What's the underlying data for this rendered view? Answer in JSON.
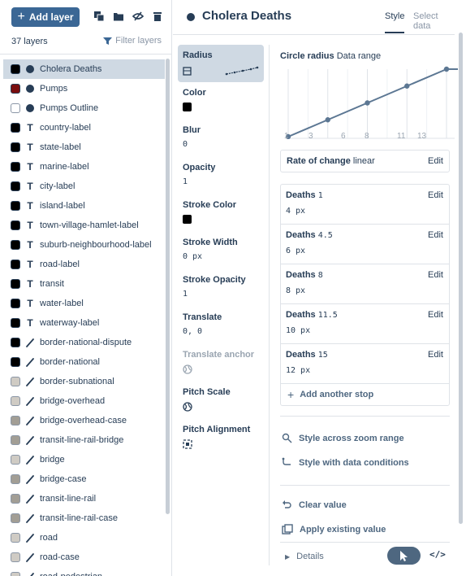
{
  "toolbar": {
    "add_layer_label": "Add layer"
  },
  "layer_panel": {
    "count_label": "37 layers",
    "filter_label": "Filter layers",
    "layers": [
      {
        "name": "Cholera Deaths",
        "icon": "circle-icon",
        "vis": "#000000",
        "selected": true
      },
      {
        "name": "Pumps",
        "icon": "circle-icon",
        "vis": "#7a0e0e"
      },
      {
        "name": "Pumps Outline",
        "icon": "circle-icon",
        "vis": "#ffffff"
      },
      {
        "name": "country-label",
        "icon": "text-icon",
        "vis": "#000000"
      },
      {
        "name": "state-label",
        "icon": "text-icon",
        "vis": "#000000"
      },
      {
        "name": "marine-label",
        "icon": "text-icon",
        "vis": "#000000"
      },
      {
        "name": "city-label",
        "icon": "text-icon",
        "vis": "#000000"
      },
      {
        "name": "island-label",
        "icon": "text-icon",
        "vis": "#000000"
      },
      {
        "name": "town-village-hamlet-label",
        "icon": "text-icon",
        "vis": "#000000"
      },
      {
        "name": "suburb-neighbourhood-label",
        "icon": "text-icon",
        "vis": "#000000"
      },
      {
        "name": "road-label",
        "icon": "text-icon",
        "vis": "#000000"
      },
      {
        "name": "transit",
        "icon": "text-icon",
        "vis": "#000000"
      },
      {
        "name": "water-label",
        "icon": "text-icon",
        "vis": "#000000"
      },
      {
        "name": "waterway-label",
        "icon": "text-icon",
        "vis": "#000000"
      },
      {
        "name": "border-national-dispute",
        "icon": "line-icon",
        "vis": "#000000"
      },
      {
        "name": "border-national",
        "icon": "line-icon",
        "vis": "#000000"
      },
      {
        "name": "border-subnational",
        "icon": "line-icon",
        "vis": "#cfcbc4"
      },
      {
        "name": "bridge-overhead",
        "icon": "line-icon",
        "vis": "#cfcbc4"
      },
      {
        "name": "bridge-overhead-case",
        "icon": "line-icon",
        "vis": "#a29e95"
      },
      {
        "name": "transit-line-rail-bridge",
        "icon": "line-icon",
        "vis": "#a29e95"
      },
      {
        "name": "bridge",
        "icon": "line-icon",
        "vis": "#cfcbc4"
      },
      {
        "name": "bridge-case",
        "icon": "line-icon",
        "vis": "#a29e95"
      },
      {
        "name": "transit-line-rail",
        "icon": "line-icon",
        "vis": "#a29e95"
      },
      {
        "name": "transit-line-rail-case",
        "icon": "line-icon",
        "vis": "#a29e95"
      },
      {
        "name": "road",
        "icon": "line-icon",
        "vis": "#cfcbc4"
      },
      {
        "name": "road-case",
        "icon": "line-icon",
        "vis": "#cfcbc4"
      },
      {
        "name": "road-pedestrian",
        "icon": "line-icon",
        "vis": "#cfcbc4"
      }
    ]
  },
  "header": {
    "title": "Cholera Deaths",
    "tab_style": "Style",
    "tab_select_data": "Select data"
  },
  "properties": [
    {
      "name": "Radius",
      "kind": "chart",
      "selected": true
    },
    {
      "name": "Color",
      "kind": "swatch",
      "color": "#000000"
    },
    {
      "name": "Blur",
      "kind": "value",
      "value": "0"
    },
    {
      "name": "Opacity",
      "kind": "value",
      "value": "1"
    },
    {
      "name": "Stroke Color",
      "kind": "swatch",
      "color": "#000000"
    },
    {
      "name": "Stroke Width",
      "kind": "value",
      "value": "0 px"
    },
    {
      "name": "Stroke Opacity",
      "kind": "value",
      "value": "1"
    },
    {
      "name": "Translate",
      "kind": "value",
      "value": "0, 0"
    },
    {
      "name": "Translate anchor",
      "kind": "icon",
      "icon": "globe-icon",
      "disabled": true
    },
    {
      "name": "Pitch Scale",
      "kind": "icon",
      "icon": "globe-icon"
    },
    {
      "name": "Pitch Alignment",
      "kind": "icon",
      "icon": "viewport-icon"
    }
  ],
  "circle_radius": {
    "label": "Circle radius",
    "mode": "Data range",
    "rate_label": "Rate of change",
    "rate_value": "linear",
    "edit_label": "Edit",
    "property": "Deaths",
    "stops": [
      {
        "key": "1",
        "value": "4 px"
      },
      {
        "key": "4.5",
        "value": "6 px"
      },
      {
        "key": "8",
        "value": "8 px"
      },
      {
        "key": "11.5",
        "value": "10 px"
      },
      {
        "key": "15",
        "value": "12 px"
      }
    ],
    "add_stop_label": "Add another stop"
  },
  "chart_data": {
    "type": "line",
    "x": [
      1,
      4.5,
      8,
      11.5,
      15
    ],
    "y": [
      4,
      6,
      8,
      10,
      12
    ],
    "tick_labels": [
      "1",
      "3",
      "6",
      "8",
      "11",
      "13"
    ],
    "xlim": [
      1,
      15
    ],
    "grid": true
  },
  "actions": {
    "zoom_range": "Style across zoom range",
    "data_conditions": "Style with data conditions",
    "clear_value": "Clear value",
    "apply_existing": "Apply existing value",
    "details": "Details"
  }
}
